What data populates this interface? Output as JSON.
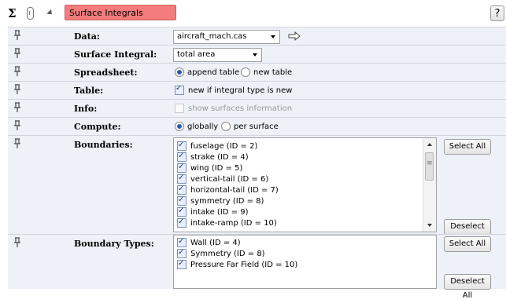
{
  "toolbar": {
    "sigma_icon": "Σ",
    "title_value": "Surface Integrals",
    "help_label": "?",
    "title_color": "#f47c7c"
  },
  "rows": {
    "data": {
      "label": "Data:",
      "value": "aircraft_mach.cas",
      "icon": "arrow-right-icon"
    },
    "surface_integral": {
      "label": "Surface Integral:",
      "value": "total area"
    },
    "spreadsheet": {
      "label": "Spreadsheet:",
      "options": [
        "append table",
        "new table"
      ],
      "selected": "append table"
    },
    "table": {
      "label": "Table:",
      "checkbox_label": "new if integral type is new",
      "checked": true
    },
    "info": {
      "label": "Info:",
      "checkbox_label": "show surfaces information",
      "checked": false,
      "enabled": false
    },
    "compute": {
      "label": "Compute:",
      "options": [
        "globally",
        "per surface"
      ],
      "selected": "globally"
    },
    "boundaries": {
      "label": "Boundaries:",
      "items": [
        "fuselage (ID = 2)",
        "strake (ID = 4)",
        "wing (ID = 5)",
        "vertical-tail (ID = 6)",
        "horizontal-tail (ID = 7)",
        "symmetry (ID = 8)",
        "intake (ID = 9)",
        "intake-ramp (ID = 10)"
      ],
      "select_all": "Select All",
      "deselect_all": "Deselect All"
    },
    "boundary_types": {
      "label": "Boundary Types:",
      "items": [
        "Wall (ID = 4)",
        "Symmetry (ID = 8)",
        "Pressure Far Field (ID = 10)"
      ],
      "select_all": "Select All",
      "deselect_all": "Deselect All"
    }
  }
}
